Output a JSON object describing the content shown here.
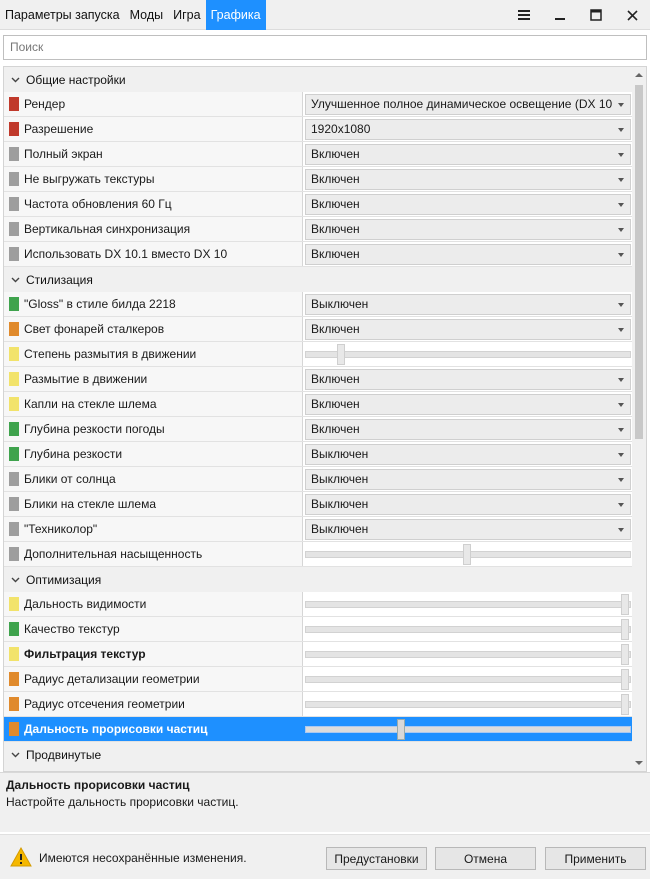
{
  "tabs": [
    {
      "label": "Параметры запуска",
      "active": false
    },
    {
      "label": "Моды",
      "active": false
    },
    {
      "label": "Игра",
      "active": false
    },
    {
      "label": "Графика",
      "active": true
    }
  ],
  "search": {
    "placeholder": "Поиск"
  },
  "categories": [
    {
      "label": "Общие настройки",
      "rows": [
        {
          "name": "Рендер",
          "color": "#c0392b",
          "type": "combo",
          "value": "Улучшенное полное динамическое освещение (DX 10"
        },
        {
          "name": "Разрешение",
          "color": "#c0392b",
          "type": "combo",
          "value": "1920x1080"
        },
        {
          "name": "Полный экран",
          "color": "#9e9e9e",
          "type": "combo",
          "value": "Включен"
        },
        {
          "name": "Не выгружать текстуры",
          "color": "#9e9e9e",
          "type": "combo",
          "value": "Включен"
        },
        {
          "name": "Частота обновления 60 Гц",
          "color": "#9e9e9e",
          "type": "combo",
          "value": "Включен"
        },
        {
          "name": "Вертикальная синхронизация",
          "color": "#9e9e9e",
          "type": "combo",
          "value": "Включен"
        },
        {
          "name": "Использовать DX 10.1 вместо DX 10",
          "color": "#9e9e9e",
          "type": "combo",
          "value": "Включен"
        }
      ]
    },
    {
      "label": "Стилизация",
      "rows": [
        {
          "name": "\"Gloss\" в стиле билда 2218",
          "color": "#3fa34d",
          "type": "combo",
          "value": "Выключен"
        },
        {
          "name": "Свет фонарей сталкеров",
          "color": "#e08a2c",
          "type": "combo",
          "value": "Включен"
        },
        {
          "name": "Степень размытия в движении",
          "color": "#f2e36b",
          "type": "slider",
          "level": 0.1
        },
        {
          "name": "Размытие в движении",
          "color": "#f2e36b",
          "type": "combo",
          "value": "Включен"
        },
        {
          "name": "Капли на стекле шлема",
          "color": "#f2e36b",
          "type": "combo",
          "value": "Включен"
        },
        {
          "name": "Глубина резкости погоды",
          "color": "#3fa34d",
          "type": "combo",
          "value": "Включен"
        },
        {
          "name": "Глубина резкости",
          "color": "#3fa34d",
          "type": "combo",
          "value": "Выключен"
        },
        {
          "name": "Блики от солнца",
          "color": "#9e9e9e",
          "type": "combo",
          "value": "Выключен"
        },
        {
          "name": "Блики на стекле шлема",
          "color": "#9e9e9e",
          "type": "combo",
          "value": "Выключен"
        },
        {
          "name": "\"Техниколор\"",
          "color": "#9e9e9e",
          "type": "combo",
          "value": "Выключен"
        },
        {
          "name": "Дополнительная насыщенность",
          "color": "#9e9e9e",
          "type": "slider",
          "level": 0.5
        }
      ]
    },
    {
      "label": "Оптимизация",
      "rows": [
        {
          "name": "Дальность видимости",
          "color": "#f2e36b",
          "type": "slider",
          "level": 1.0
        },
        {
          "name": "Качество текстур",
          "color": "#3fa34d",
          "type": "slider",
          "level": 1.0
        },
        {
          "name": "Фильтрация текстур",
          "color": "#f2e36b",
          "type": "slider",
          "level": 1.0,
          "bold": true
        },
        {
          "name": "Радиус детализации геометрии",
          "color": "#e08a2c",
          "type": "slider",
          "level": 1.0
        },
        {
          "name": "Радиус отсечения геометрии",
          "color": "#e08a2c",
          "type": "slider",
          "level": 1.0
        },
        {
          "name": "Дальность прорисовки частиц",
          "color": "#e08a2c",
          "type": "slider",
          "level": 0.29,
          "selected": true
        }
      ]
    },
    {
      "label": "Продвинутые",
      "rows": []
    }
  ],
  "description": {
    "title": "Дальность прорисовки частиц",
    "text": "Настройте дальность прорисовки частиц."
  },
  "footer": {
    "warning": "Имеются несохранённые изменения.",
    "presets_label": "Предустановки",
    "cancel_label": "Отмена",
    "apply_label": "Применить"
  }
}
